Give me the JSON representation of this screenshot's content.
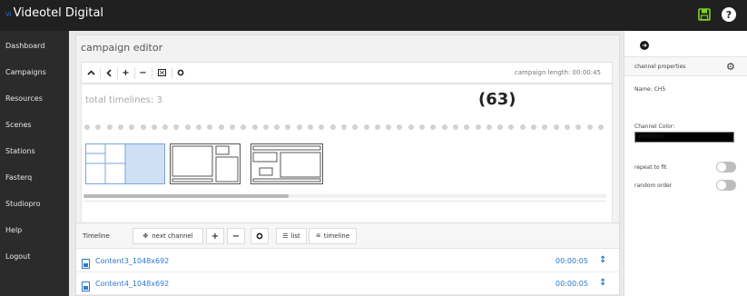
{
  "app": {
    "brand_small": "Vi",
    "title": "Videotel Digital"
  },
  "sidebar": {
    "items": [
      {
        "label": "Dashboard"
      },
      {
        "label": "Campaigns"
      },
      {
        "label": "Resources"
      },
      {
        "label": "Scenes"
      },
      {
        "label": "Stations"
      },
      {
        "label": "Fasterq"
      },
      {
        "label": "Studiopro"
      },
      {
        "label": "Help"
      },
      {
        "label": "Logout"
      }
    ]
  },
  "editor": {
    "title": "campaign editor",
    "campaign_length": "campaign length: 00:00:45",
    "total_timelines": "total timelines: 3",
    "count_label": "(63)"
  },
  "timeline": {
    "label": "Timeline",
    "next_channel": "next channel",
    "add": "+",
    "remove": "−",
    "list": "list",
    "timeline_view": "timeline",
    "rows": [
      {
        "name": "Content3_1048x692",
        "duration": "00:00:05"
      },
      {
        "name": "Content4_1048x692",
        "duration": "00:00:05"
      }
    ]
  },
  "properties": {
    "header": "channel properties",
    "name_line": "Name: CH5",
    "color_label": "Channel Color:",
    "color_value": "#000000",
    "repeat_label": "repeat to fit",
    "random_label": "random order"
  },
  "colors": {
    "topbar": "#202020",
    "sidebar": "#2b2b2b",
    "link": "#2a7ad0",
    "save_icon": "#7ed321",
    "selected_region": "#cfe0f5"
  },
  "icons": {
    "save": "floppy-disk-icon",
    "help": "question-icon",
    "back": "arrow-circle-icon",
    "settings": "gear-icon"
  }
}
